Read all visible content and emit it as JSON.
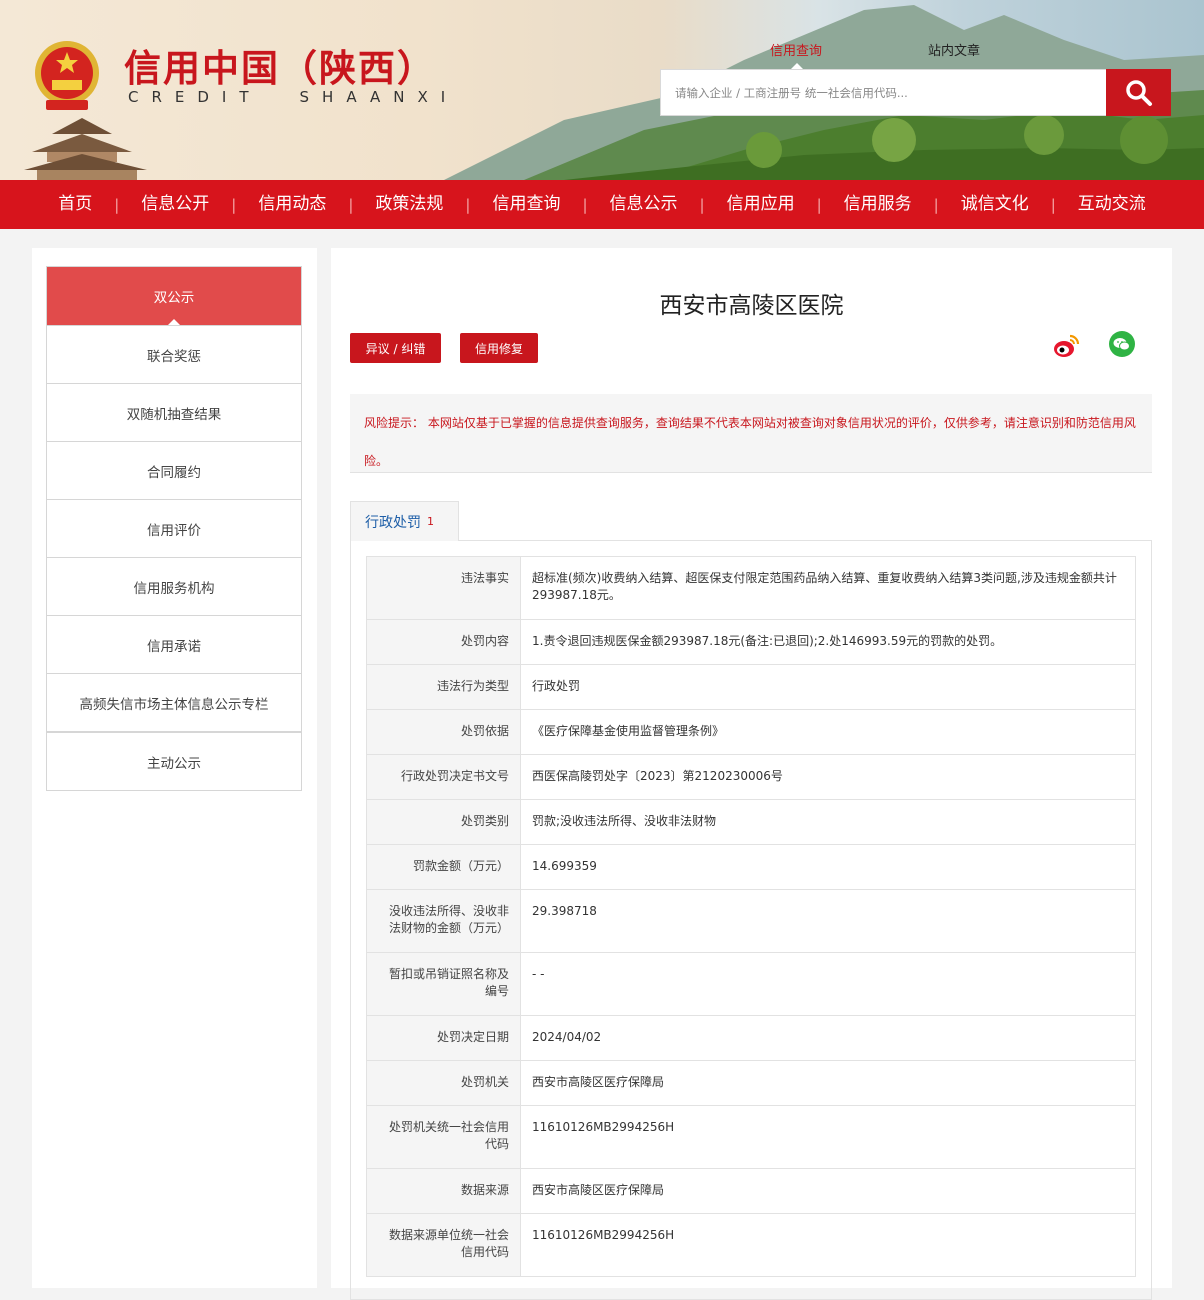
{
  "brand": {
    "title": "信用中国（陕西）",
    "subtitle_left": "CREDIT",
    "subtitle_right": "SHAANXI"
  },
  "search": {
    "tab_query": "信用查询",
    "tab_article": "站内文章",
    "placeholder": "请输入企业 / 工商注册号 统一社会信用代码..."
  },
  "nav": {
    "items": [
      "首页",
      "信息公开",
      "信用动态",
      "政策法规",
      "信用查询",
      "信息公示",
      "信用应用",
      "信用服务",
      "诚信文化",
      "互动交流"
    ]
  },
  "sidebar": {
    "items": [
      "双公示",
      "联合奖惩",
      "双随机抽查结果",
      "合同履约",
      "信用评价",
      "信用服务机构",
      "信用承诺",
      "高频失信市场主体信息公示专栏",
      "主动公示"
    ]
  },
  "main": {
    "entity_name": "西安市高陵区医院",
    "objection_button": "异议 / 纠错",
    "repair_button": "信用修复",
    "risk_notice": "风险提示： 本网站仅基于已掌握的信息提供查询服务，查询结果不代表本网站对被查询对象信用状况的评价，仅供参考，请注意识别和防范信用风险。",
    "tab_label": "行政处罚",
    "tab_count": "1",
    "rows": [
      {
        "k": "违法事实",
        "v": "超标准(频次)收费纳入结算、超医保支付限定范围药品纳入结算、重复收费纳入结算3类问题,涉及违规金额共计293987.18元。"
      },
      {
        "k": "处罚内容",
        "v": "1.责令退回违规医保金额293987.18元(备注:已退回);2.处146993.59元的罚款的处罚。"
      },
      {
        "k": "违法行为类型",
        "v": "行政处罚"
      },
      {
        "k": "处罚依据",
        "v": "《医疗保障基金使用监督管理条例》"
      },
      {
        "k": "行政处罚决定书文号",
        "v": "西医保高陵罚处字〔2023〕第2120230006号"
      },
      {
        "k": "处罚类别",
        "v": "罚款;没收违法所得、没收非法财物"
      },
      {
        "k": "罚款金额（万元）",
        "v": "14.699359"
      },
      {
        "k": "没收违法所得、没收非法财物的金额（万元）",
        "v": "29.398718"
      },
      {
        "k": "暂扣或吊销证照名称及编号",
        "v": "- -"
      },
      {
        "k": "处罚决定日期",
        "v": "2024/04/02"
      },
      {
        "k": "处罚机关",
        "v": "西安市高陵区医疗保障局"
      },
      {
        "k": "处罚机关统一社会信用代码",
        "v": "11610126MB2994256H"
      },
      {
        "k": "数据来源",
        "v": "西安市高陵区医疗保障局"
      },
      {
        "k": "数据来源单位统一社会信用代码",
        "v": "11610126MB2994256H"
      }
    ]
  }
}
